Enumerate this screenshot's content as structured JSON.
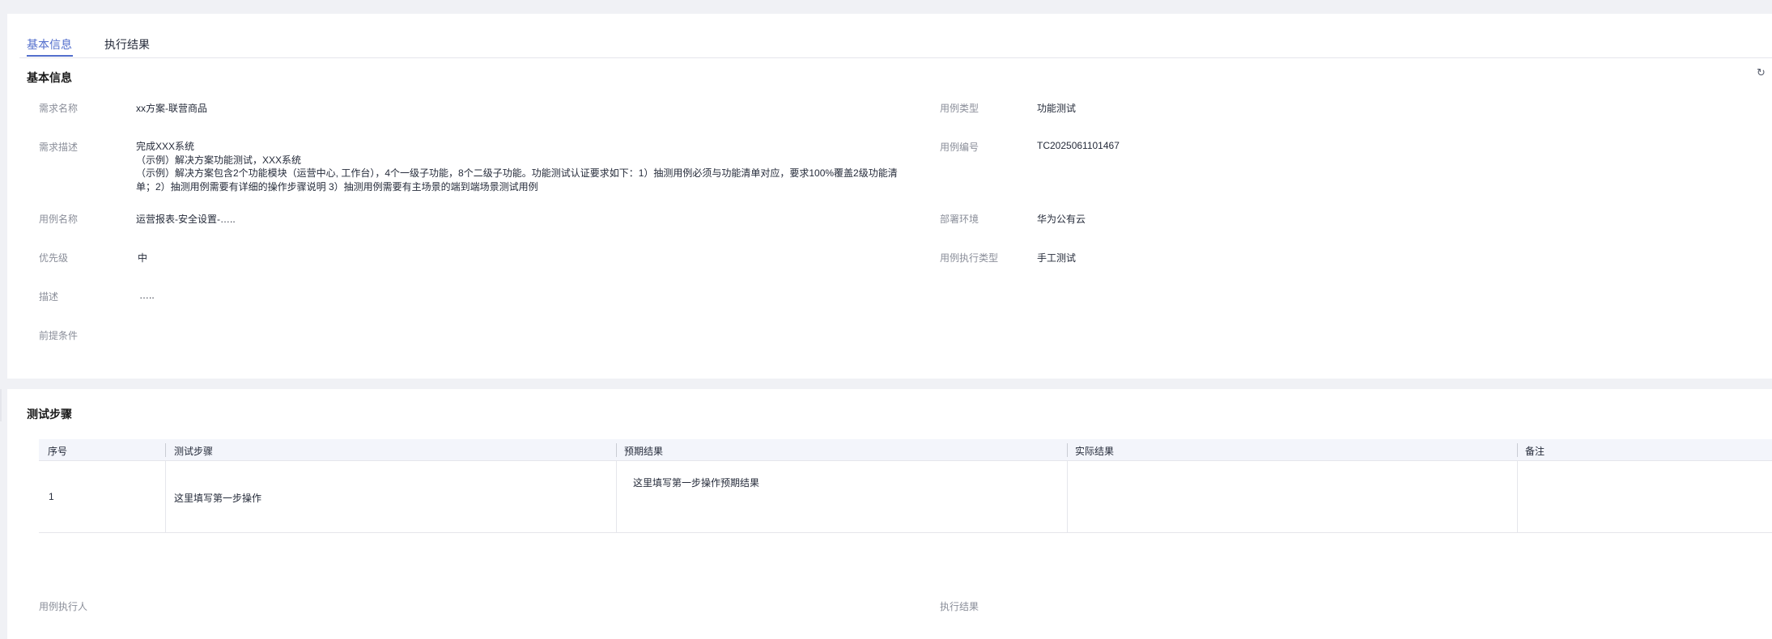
{
  "tabs": [
    {
      "label": "基本信息",
      "active": true
    },
    {
      "label": "执行结果",
      "active": false
    }
  ],
  "basic_info": {
    "title": "基本信息",
    "refresh_icon": "refresh-icon",
    "fields_left": {
      "requirement_name": {
        "label": "需求名称",
        "value": "xx方案-联营商品"
      },
      "requirement_desc": {
        "label": "需求描述",
        "lines": [
          "完成XXX系统",
          "（示例）解决方案功能测试，XXX系统",
          "（示例）解决方案包含2个功能模块（运营中心, 工作台），4个一级子功能，8个二级子功能。功能测试认证要求如下：1）抽测用例必须与功能清单对应，要求100%覆盖2级功能清",
          "单；2）抽测用例需要有详细的操作步骤说明 3）抽测用例需要有主场景的端到端场景测试用例"
        ]
      },
      "case_name": {
        "label": "用例名称",
        "value": "运营报表-安全设置-….."
      },
      "priority": {
        "label": "优先级",
        "value": "中"
      },
      "description": {
        "label": "描述",
        "value": "….."
      },
      "precondition": {
        "label": "前提条件",
        "value": ""
      }
    },
    "fields_right": {
      "case_type": {
        "label": "用例类型",
        "value": "功能测试"
      },
      "case_number": {
        "label": "用例编号",
        "value": "TC2025061101467"
      },
      "deploy_env": {
        "label": "部署环境",
        "value": "华为公有云"
      },
      "exec_type": {
        "label": "用例执行类型",
        "value": "手工测试"
      }
    }
  },
  "test_steps": {
    "title": "测试步骤",
    "columns": [
      "序号",
      "测试步骤",
      "预期结果",
      "实际结果",
      "备注"
    ],
    "rows": [
      {
        "index": "1",
        "step": "这里填写第一步操作",
        "expected": "这里填写第一步操作预期结果",
        "actual": "",
        "remark": ""
      }
    ],
    "executor_label": "用例执行人",
    "result_label": "执行结果"
  }
}
